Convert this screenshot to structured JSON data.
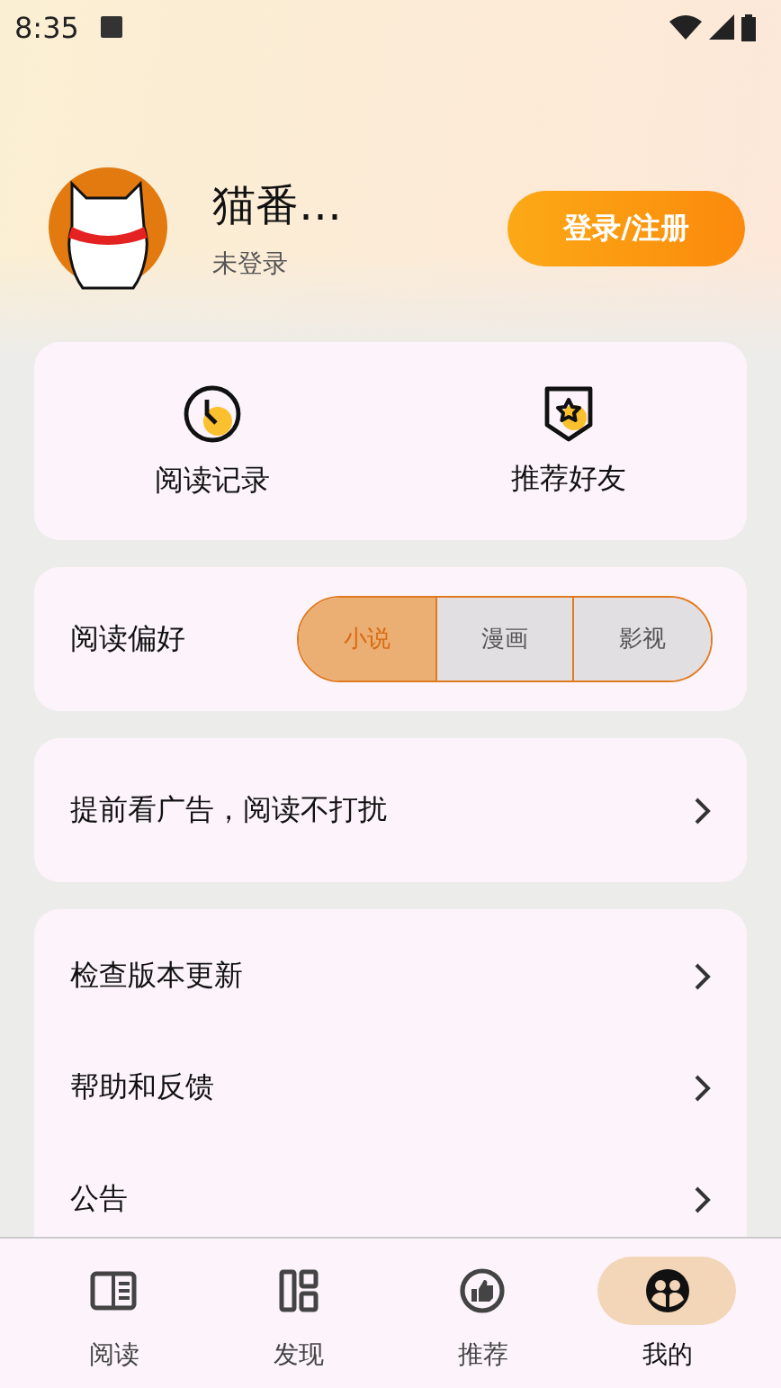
{
  "status_bar": {
    "time": "8:35"
  },
  "profile": {
    "name": "猫番…",
    "status": "未登录",
    "login_button": "登录/注册"
  },
  "shortcuts": [
    {
      "kind": "history",
      "label": "阅读记录"
    },
    {
      "kind": "recommend",
      "label": "推荐好友"
    }
  ],
  "preference": {
    "label": "阅读偏好",
    "options": [
      {
        "label": "小说",
        "selected": true
      },
      {
        "label": "漫画",
        "selected": false
      },
      {
        "label": "影视",
        "selected": false
      }
    ]
  },
  "ad_row": {
    "label": "提前看广告，阅读不打扰"
  },
  "menu": [
    {
      "label": "检查版本更新"
    },
    {
      "label": "帮助和反馈"
    },
    {
      "label": "公告"
    }
  ],
  "nav": [
    {
      "kind": "read",
      "label": "阅读",
      "selected": false
    },
    {
      "kind": "discover",
      "label": "发现",
      "selected": false
    },
    {
      "kind": "recommend",
      "label": "推荐",
      "selected": false
    },
    {
      "kind": "mine",
      "label": "我的",
      "selected": true
    }
  ]
}
